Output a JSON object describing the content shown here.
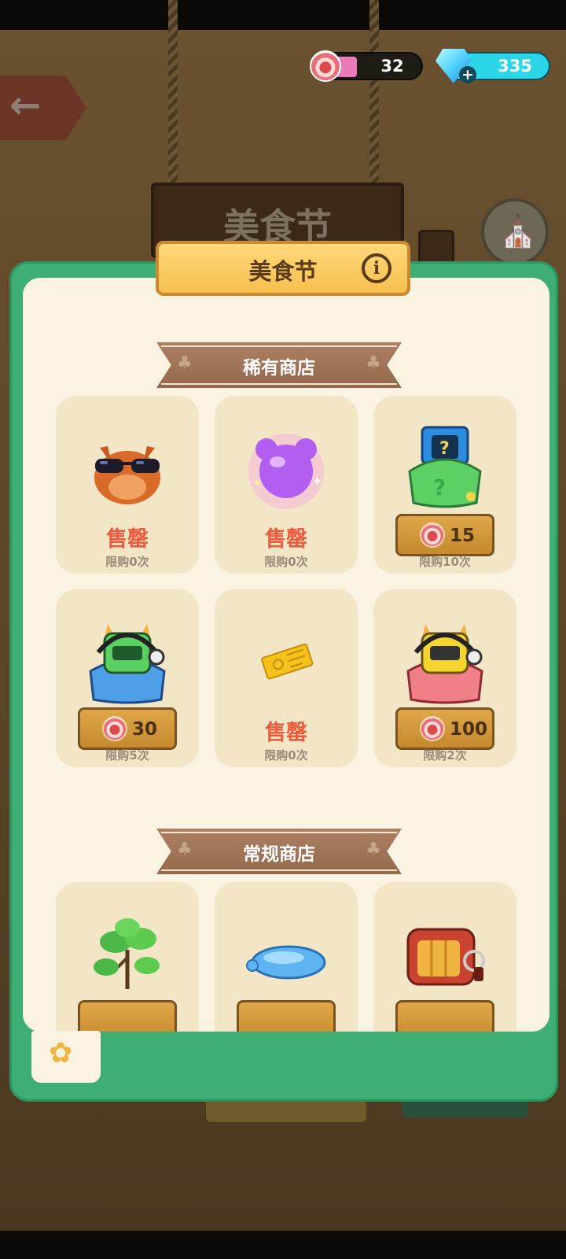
{
  "background": {
    "sign_title": "美食节",
    "back_icon": "back-arrow-icon",
    "shop_icon": "shop-icon"
  },
  "currency": {
    "food_tokens": "32",
    "gems": "335",
    "food_icon": "donut-token-icon",
    "gem_icon": "gem-icon"
  },
  "dialog": {
    "title": "美食节",
    "info_icon": "info-icon"
  },
  "rare_shop": {
    "title": "稀有商店",
    "items": [
      {
        "icon": "sunglasses-bird-icon",
        "sold_out": "售罄",
        "limit": "限购0次"
      },
      {
        "icon": "purple-bear-jelly-icon",
        "sold_out": "售罄",
        "limit": "限购0次"
      },
      {
        "icon": "mystery-bag-icon",
        "price": "15",
        "limit": "限购10次"
      },
      {
        "icon": "green-robot-cat-icon",
        "price": "30",
        "limit": "限购5次"
      },
      {
        "icon": "golden-ticket-icon",
        "sold_out": "售罄",
        "limit": "限购0次"
      },
      {
        "icon": "yellow-robot-cat-icon",
        "price": "100",
        "limit": "限购2次"
      }
    ]
  },
  "regular_shop": {
    "title": "常规商店",
    "items": [
      {
        "icon": "herb-plant-icon"
      },
      {
        "icon": "blue-jelly-puddle-icon"
      },
      {
        "icon": "red-toaster-icon"
      }
    ]
  },
  "colors": {
    "dialog_green": "#3fae75",
    "panel_cream": "#faf3e2",
    "sold_red": "#ec5b3c",
    "price_gold": "#d39a3d"
  },
  "tabs": [
    {
      "icon": "leaf-tab-icon"
    }
  ]
}
